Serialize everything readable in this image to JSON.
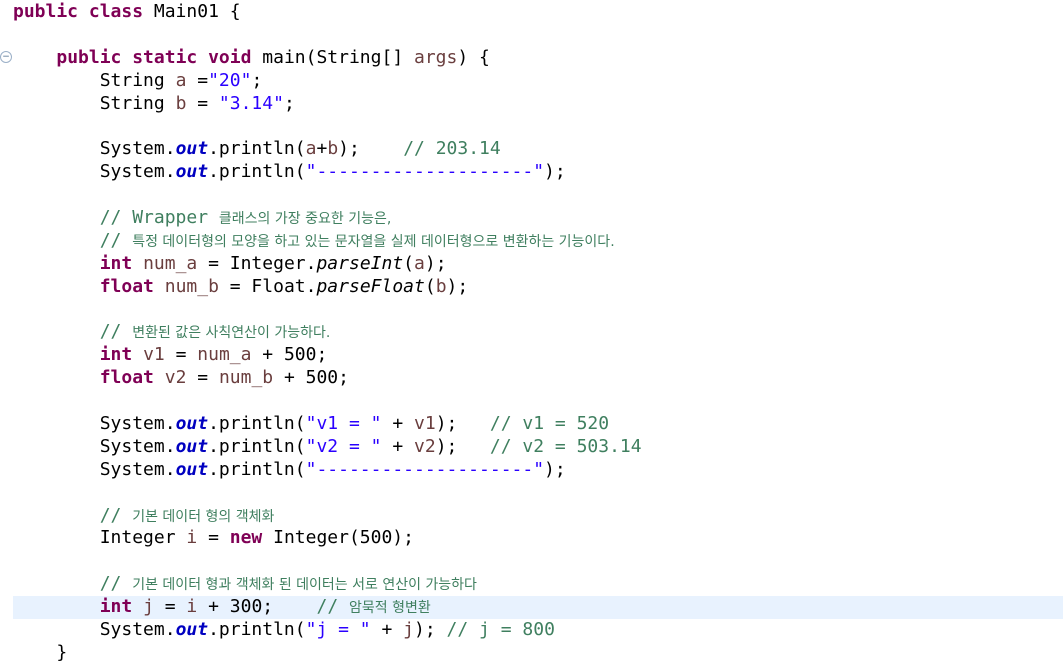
{
  "editor": {
    "fold_icon": "collapse-icon",
    "colors": {
      "keyword": "#7f0055",
      "string": "#2a00ff",
      "comment": "#3f7f5f",
      "field": "#0000c0",
      "current_line": "#e8f2fe"
    },
    "lines": [
      {
        "tokens": [
          {
            "t": "public class",
            "c": "kw"
          },
          {
            "t": " Main01 {",
            "c": "txt"
          }
        ]
      },
      {
        "tokens": []
      },
      {
        "tokens": [
          {
            "t": "    ",
            "c": "txt"
          },
          {
            "t": "public static void",
            "c": "kw"
          },
          {
            "t": " main(String[] ",
            "c": "txt"
          },
          {
            "t": "args",
            "c": "var"
          },
          {
            "t": ") {",
            "c": "txt"
          }
        ]
      },
      {
        "tokens": [
          {
            "t": "        String ",
            "c": "txt"
          },
          {
            "t": "a",
            "c": "var"
          },
          {
            "t": " =",
            "c": "txt"
          },
          {
            "t": "\"20\"",
            "c": "str"
          },
          {
            "t": ";",
            "c": "txt"
          }
        ]
      },
      {
        "tokens": [
          {
            "t": "        String ",
            "c": "txt"
          },
          {
            "t": "b",
            "c": "var"
          },
          {
            "t": " = ",
            "c": "txt"
          },
          {
            "t": "\"3.14\"",
            "c": "str"
          },
          {
            "t": ";",
            "c": "txt"
          }
        ]
      },
      {
        "tokens": []
      },
      {
        "tokens": [
          {
            "t": "        System.",
            "c": "txt"
          },
          {
            "t": "out",
            "c": "fld"
          },
          {
            "t": ".println(",
            "c": "txt"
          },
          {
            "t": "a",
            "c": "var"
          },
          {
            "t": "+",
            "c": "txt"
          },
          {
            "t": "b",
            "c": "var"
          },
          {
            "t": ");    ",
            "c": "txt"
          },
          {
            "t": "// 203.14",
            "c": "cm"
          }
        ]
      },
      {
        "tokens": [
          {
            "t": "        System.",
            "c": "txt"
          },
          {
            "t": "out",
            "c": "fld"
          },
          {
            "t": ".println(",
            "c": "txt"
          },
          {
            "t": "\"--------------------\"",
            "c": "str"
          },
          {
            "t": ");",
            "c": "txt"
          }
        ]
      },
      {
        "tokens": []
      },
      {
        "tokens": [
          {
            "t": "        ",
            "c": "txt"
          },
          {
            "t": "// Wrapper ",
            "c": "cm"
          },
          {
            "t": "클래스의 가장 중요한 기능은,",
            "c": "cm-ko"
          }
        ]
      },
      {
        "tokens": [
          {
            "t": "        ",
            "c": "txt"
          },
          {
            "t": "// ",
            "c": "cm"
          },
          {
            "t": "특정 데이터형의 모양을 하고 있는 문자열을 실제 데이터형으로 변환하는 기능이다.",
            "c": "cm-ko"
          }
        ]
      },
      {
        "tokens": [
          {
            "t": "        ",
            "c": "txt"
          },
          {
            "t": "int",
            "c": "kw"
          },
          {
            "t": " ",
            "c": "txt"
          },
          {
            "t": "num_a",
            "c": "var"
          },
          {
            "t": " = Integer.",
            "c": "txt"
          },
          {
            "t": "parseInt",
            "c": "it"
          },
          {
            "t": "(",
            "c": "txt"
          },
          {
            "t": "a",
            "c": "var"
          },
          {
            "t": ");",
            "c": "txt"
          }
        ]
      },
      {
        "tokens": [
          {
            "t": "        ",
            "c": "txt"
          },
          {
            "t": "float",
            "c": "kw"
          },
          {
            "t": " ",
            "c": "txt"
          },
          {
            "t": "num_b",
            "c": "var"
          },
          {
            "t": " = Float.",
            "c": "txt"
          },
          {
            "t": "parseFloat",
            "c": "it"
          },
          {
            "t": "(",
            "c": "txt"
          },
          {
            "t": "b",
            "c": "var"
          },
          {
            "t": ");",
            "c": "txt"
          }
        ]
      },
      {
        "tokens": []
      },
      {
        "tokens": [
          {
            "t": "        ",
            "c": "txt"
          },
          {
            "t": "// ",
            "c": "cm"
          },
          {
            "t": "변환된 값은 사칙연산이 가능하다.",
            "c": "cm-ko"
          }
        ]
      },
      {
        "tokens": [
          {
            "t": "        ",
            "c": "txt"
          },
          {
            "t": "int",
            "c": "kw"
          },
          {
            "t": " ",
            "c": "txt"
          },
          {
            "t": "v1",
            "c": "var"
          },
          {
            "t": " = ",
            "c": "txt"
          },
          {
            "t": "num_a",
            "c": "var"
          },
          {
            "t": " + 500;",
            "c": "txt"
          }
        ]
      },
      {
        "tokens": [
          {
            "t": "        ",
            "c": "txt"
          },
          {
            "t": "float",
            "c": "kw"
          },
          {
            "t": " ",
            "c": "txt"
          },
          {
            "t": "v2",
            "c": "var"
          },
          {
            "t": " = ",
            "c": "txt"
          },
          {
            "t": "num_b",
            "c": "var"
          },
          {
            "t": " + 500;",
            "c": "txt"
          }
        ]
      },
      {
        "tokens": []
      },
      {
        "tokens": [
          {
            "t": "        System.",
            "c": "txt"
          },
          {
            "t": "out",
            "c": "fld"
          },
          {
            "t": ".println(",
            "c": "txt"
          },
          {
            "t": "\"v1 = \"",
            "c": "str"
          },
          {
            "t": " + ",
            "c": "txt"
          },
          {
            "t": "v1",
            "c": "var"
          },
          {
            "t": ");   ",
            "c": "txt"
          },
          {
            "t": "// v1 = 520",
            "c": "cm"
          }
        ]
      },
      {
        "tokens": [
          {
            "t": "        System.",
            "c": "txt"
          },
          {
            "t": "out",
            "c": "fld"
          },
          {
            "t": ".println(",
            "c": "txt"
          },
          {
            "t": "\"v2 = \"",
            "c": "str"
          },
          {
            "t": " + ",
            "c": "txt"
          },
          {
            "t": "v2",
            "c": "var"
          },
          {
            "t": ");   ",
            "c": "txt"
          },
          {
            "t": "// v2 = 503.14",
            "c": "cm"
          }
        ]
      },
      {
        "tokens": [
          {
            "t": "        System.",
            "c": "txt"
          },
          {
            "t": "out",
            "c": "fld"
          },
          {
            "t": ".println(",
            "c": "txt"
          },
          {
            "t": "\"--------------------\"",
            "c": "str"
          },
          {
            "t": ");",
            "c": "txt"
          }
        ]
      },
      {
        "tokens": []
      },
      {
        "tokens": [
          {
            "t": "        ",
            "c": "txt"
          },
          {
            "t": "// ",
            "c": "cm"
          },
          {
            "t": "기본 데이터 형의 객체화",
            "c": "cm-ko"
          }
        ]
      },
      {
        "tokens": [
          {
            "t": "        Integer ",
            "c": "txt"
          },
          {
            "t": "i",
            "c": "var"
          },
          {
            "t": " = ",
            "c": "txt"
          },
          {
            "t": "new",
            "c": "kw"
          },
          {
            "t": " Integer(500);",
            "c": "txt"
          }
        ]
      },
      {
        "tokens": []
      },
      {
        "tokens": [
          {
            "t": "        ",
            "c": "txt"
          },
          {
            "t": "// ",
            "c": "cm"
          },
          {
            "t": "기본 데이터 형과 객체화 된 데이터는 서로 연산이 가능하다",
            "c": "cm-ko"
          }
        ]
      },
      {
        "current": true,
        "tokens": [
          {
            "t": "        ",
            "c": "txt"
          },
          {
            "t": "int",
            "c": "kw"
          },
          {
            "t": " ",
            "c": "txt"
          },
          {
            "t": "j",
            "c": "var"
          },
          {
            "t": " = ",
            "c": "txt"
          },
          {
            "t": "i",
            "c": "var"
          },
          {
            "t": " + 300;    ",
            "c": "txt"
          },
          {
            "t": "// ",
            "c": "cm"
          },
          {
            "t": "암묵적 형변환",
            "c": "cm-ko"
          }
        ]
      },
      {
        "tokens": [
          {
            "t": "        System.",
            "c": "txt"
          },
          {
            "t": "out",
            "c": "fld"
          },
          {
            "t": ".println(",
            "c": "txt"
          },
          {
            "t": "\"j = \"",
            "c": "str"
          },
          {
            "t": " + ",
            "c": "txt"
          },
          {
            "t": "j",
            "c": "var"
          },
          {
            "t": "); ",
            "c": "txt"
          },
          {
            "t": "// j = 800",
            "c": "cm"
          }
        ]
      },
      {
        "tokens": [
          {
            "t": "    }",
            "c": "txt"
          }
        ]
      }
    ]
  }
}
